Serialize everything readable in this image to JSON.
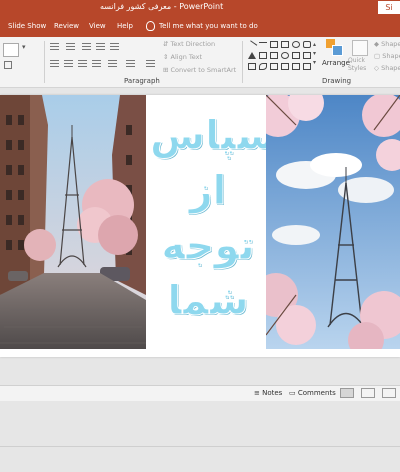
{
  "titlebar": {
    "document_name": "معرفی کشور فرانسه",
    "separator": " - ",
    "app_name": "PowerPoint",
    "signin": "Si"
  },
  "tabs": [
    {
      "label": "Slide Show"
    },
    {
      "label": "Review"
    },
    {
      "label": "View"
    },
    {
      "label": "Help"
    }
  ],
  "tell_me": "Tell me what you want to do",
  "ribbon": {
    "paragraph": {
      "label": "Paragraph",
      "text_direction": "Text Direction",
      "align_text": "Align Text",
      "convert_smartart": "Convert to SmartArt"
    },
    "drawing": {
      "label": "Drawing",
      "arrange": "Arrange",
      "quick_styles": "Quick Styles",
      "shape_fill": "Shape",
      "shape_outline": "Shape",
      "shape_effects": "Shape"
    }
  },
  "slide": {
    "thanks_lines": [
      "سپاس",
      "از",
      "توجه",
      "شما"
    ]
  },
  "statusbar": {
    "notes": "Notes",
    "comments": "Comments"
  },
  "colors": {
    "accent": "#b7472a",
    "thanks_text": "#8ed8ee"
  }
}
